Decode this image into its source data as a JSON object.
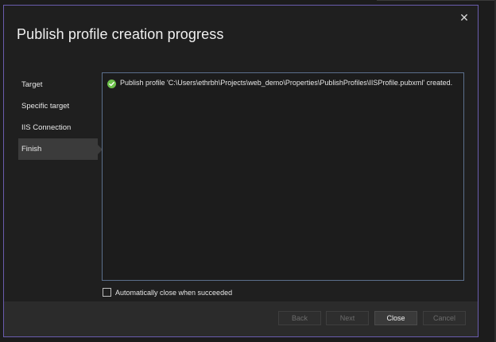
{
  "dialog": {
    "title": "Publish profile creation progress",
    "close_glyph": "✕"
  },
  "nav": {
    "items": [
      {
        "label": "Target",
        "selected": false
      },
      {
        "label": "Specific target",
        "selected": false
      },
      {
        "label": "IIS Connection",
        "selected": false
      },
      {
        "label": "Finish",
        "selected": true
      }
    ]
  },
  "output": {
    "status_icon": "success-check-icon",
    "message": "Publish profile 'C:\\Users\\ethrbh\\Projects\\web_demo\\Properties\\PublishProfiles\\IISProfile.pubxml' created."
  },
  "auto_close": {
    "label": "Automatically close when succeeded",
    "checked": false
  },
  "footer": {
    "back_label": "Back",
    "next_label": "Next",
    "close_label": "Close",
    "cancel_label": "Cancel"
  },
  "colors": {
    "accent_border": "#6a5cae",
    "success_green": "#6cc04a",
    "output_border": "#5b6f8c"
  }
}
